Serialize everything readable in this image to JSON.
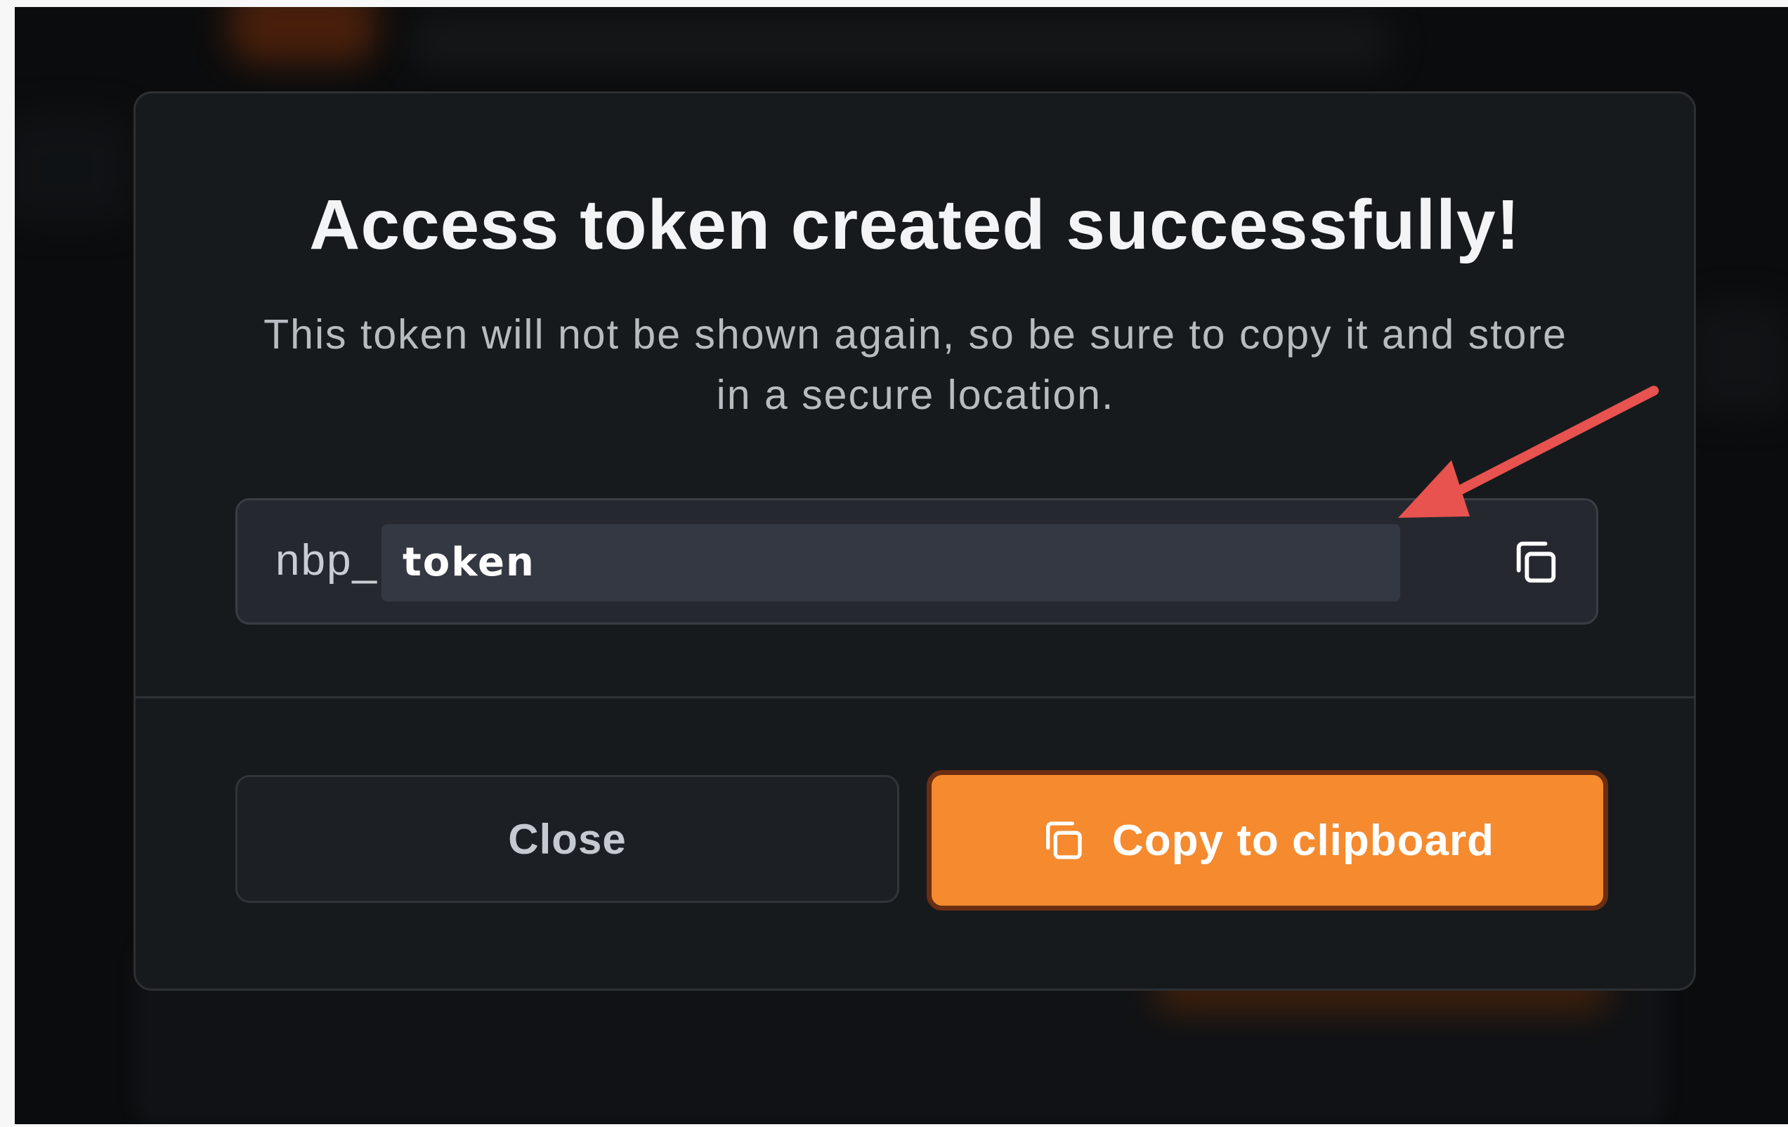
{
  "modal": {
    "title": "Access token created successfully!",
    "description": "This token will not be shown again, so be sure to copy it and store in a secure location.",
    "token_prefix": "nbp_",
    "token_value": "token"
  },
  "actions": {
    "close_label": "Close",
    "copy_label": "Copy to clipboard"
  },
  "colors": {
    "accent": "#f58a2e",
    "annotation_arrow": "#e8524f",
    "modal_bg": "#161a1c"
  },
  "icons": {
    "token_copy": "copy-icon",
    "button_copy": "copy-icon"
  }
}
